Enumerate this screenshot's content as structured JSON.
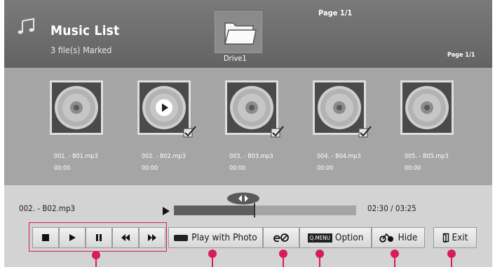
{
  "header": {
    "title": "Music List",
    "subtitle": "3 file(s) Marked",
    "drive_label": "Drive1",
    "page_top": "Page 1/1",
    "page_right": "Page 1/1"
  },
  "files": [
    {
      "name": "001. - B01.mp3",
      "time": "00:00",
      "marked": false,
      "playing": false
    },
    {
      "name": "002. - B02.mp3",
      "time": "00:00",
      "marked": true,
      "playing": true
    },
    {
      "name": "003. - B03.mp3",
      "time": "00:00",
      "marked": true,
      "playing": false
    },
    {
      "name": "004. - B04.mp3",
      "time": "00:00",
      "marked": true,
      "playing": false
    },
    {
      "name": "005. - B05.mp3",
      "time": "00:00",
      "marked": false,
      "playing": false
    }
  ],
  "player": {
    "now_playing": "002. - B02.mp3",
    "time": "02:30 / 03:25",
    "progress": 0.44
  },
  "buttons": {
    "play_with_photo": "Play with Photo",
    "qmenu_tag": "Q.MENU",
    "option": "Option",
    "hide": "Hide",
    "exit": "Exit"
  },
  "icons": {
    "stop": "stop-icon",
    "play": "play-icon",
    "pause": "pause-icon",
    "rewind": "rewind-icon",
    "fast_forward": "fast-forward-icon",
    "energy": "energy-saving-icon",
    "hide": "hide-icon",
    "exit": "exit-icon"
  },
  "colors": {
    "annotation": "#d81b60",
    "grid_bg": "#a5a5a5",
    "control_bg": "#d3d3d3"
  }
}
